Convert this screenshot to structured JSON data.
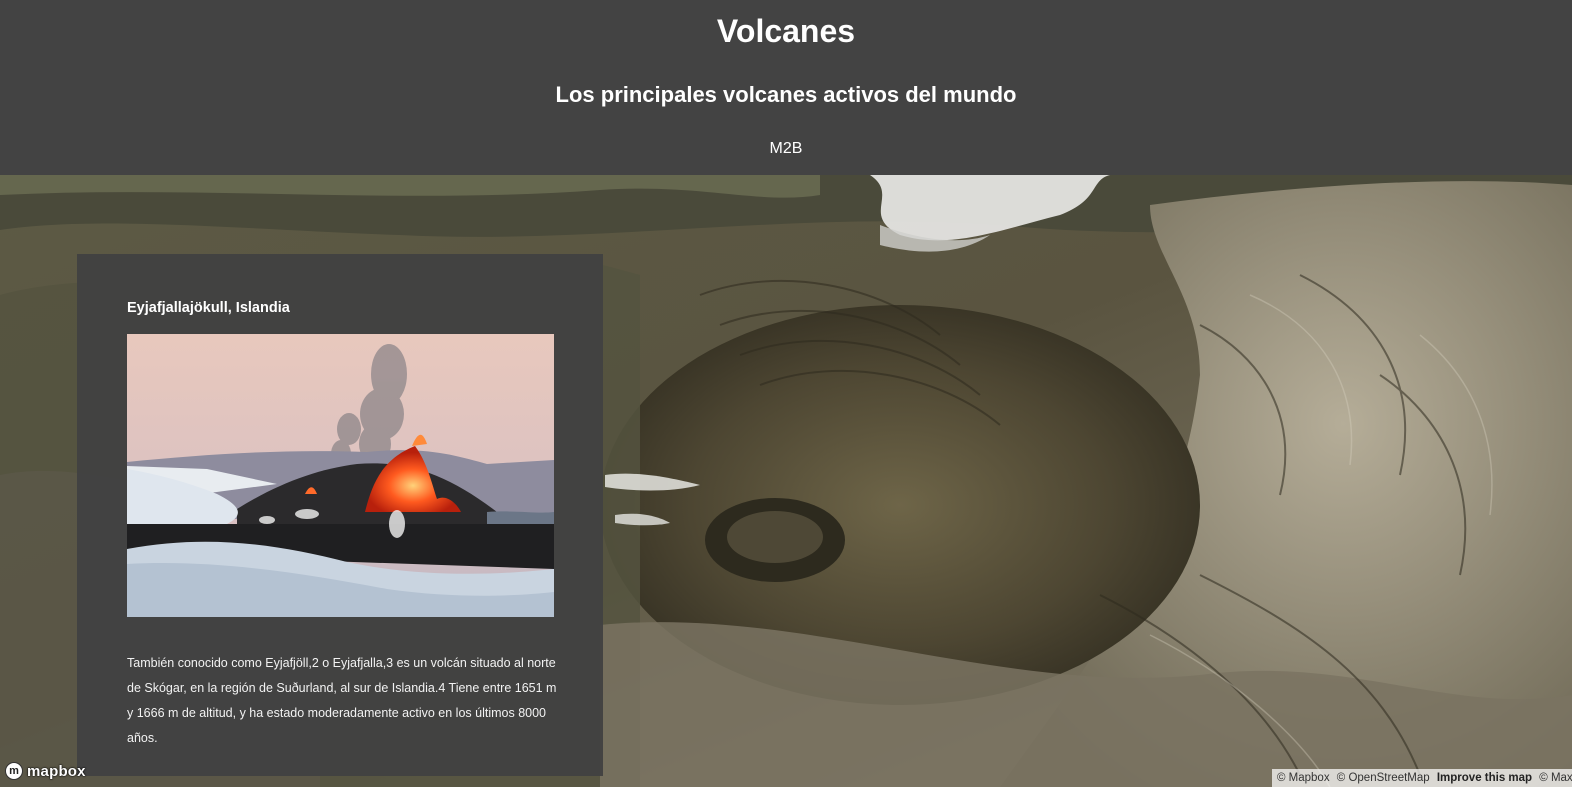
{
  "header": {
    "title": "Volcanes",
    "subtitle": "Los principales volcanes activos del mundo",
    "byline": "M2B"
  },
  "chapter": {
    "title": "Eyjafjallajökull, Islandia",
    "description": "También conocido como Eyjafjöll,2 o Eyjafjalla,3 es un volcán situado al norte de Skógar, en la región de Suðurland, al sur de Islandia.4 Tiene entre 1651 m y 1666 m de altitud, y ha estado moderadamente activo en los últimos 8000 años."
  },
  "map_chrome": {
    "logo_text": "mapbox",
    "attribution": {
      "mapbox": "© Mapbox",
      "osm": "© OpenStreetMap",
      "improve": "Improve this map",
      "maxar": "© Maxar"
    }
  },
  "colors": {
    "header_bg": "#434343",
    "panel_bg": "#424242",
    "text": "#ffffff"
  }
}
